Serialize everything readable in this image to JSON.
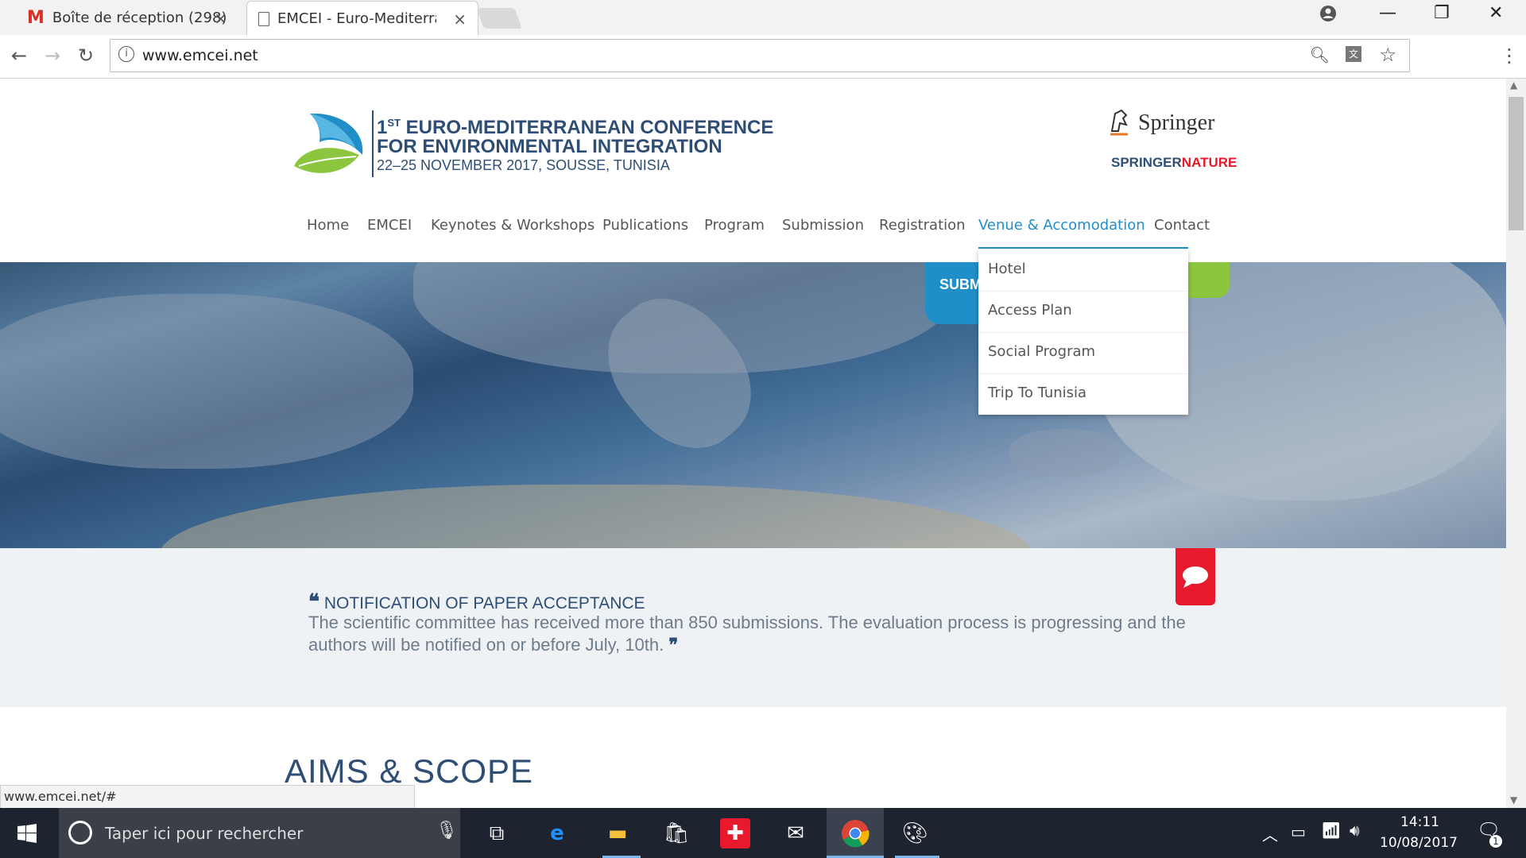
{
  "browser": {
    "tabs": [
      {
        "label": "Boîte de réception (298)",
        "icon": "gmail-icon"
      },
      {
        "label": "EMCEI - Euro-Mediterran",
        "icon": "page-icon"
      }
    ],
    "url": "www.emcei.net",
    "status_url": "www.emcei.net/#"
  },
  "site": {
    "logo": {
      "superscript_num": "1",
      "superscript_st": "ST",
      "line1": "EURO-MEDITERRANEAN CONFERENCE",
      "line2": "FOR ENVIRONMENTAL INTEGRATION",
      "line3": "22–25 NOVEMBER 2017, SOUSSE, TUNISIA"
    },
    "partner": {
      "springer": "Springer",
      "springer_nature_1": "SPRINGER",
      "springer_nature_2": "NATURE"
    },
    "nav": [
      "Home",
      "EMCEI",
      "Keynotes & Workshops",
      "Publications",
      "Program",
      "Submission",
      "Registration",
      "Venue & Accomodation",
      "Contact"
    ],
    "active_nav": "Venue & Accomodation",
    "dropdown": [
      "Hotel",
      "Access Plan",
      "Social Program",
      "Trip To Tunisia"
    ],
    "hero_badge": "SUBM",
    "notification": {
      "title": "NOTIFICATION OF PAPER ACCEPTANCE",
      "body": "The scientific committee has received more than 850 submissions. The evaluation process is progressing and the authors will be notified on or before July, 10th."
    },
    "section_heading": "AIMS & SCOPE"
  },
  "taskbar": {
    "search_placeholder": "Taper ici pour rechercher",
    "time": "14:11",
    "date": "10/08/2017",
    "notification_count": "1"
  },
  "colors": {
    "accent": "#1f8ec9",
    "logo_navy": "#2e4e75",
    "chat_red": "#e8192c",
    "green": "#8cc63f"
  }
}
